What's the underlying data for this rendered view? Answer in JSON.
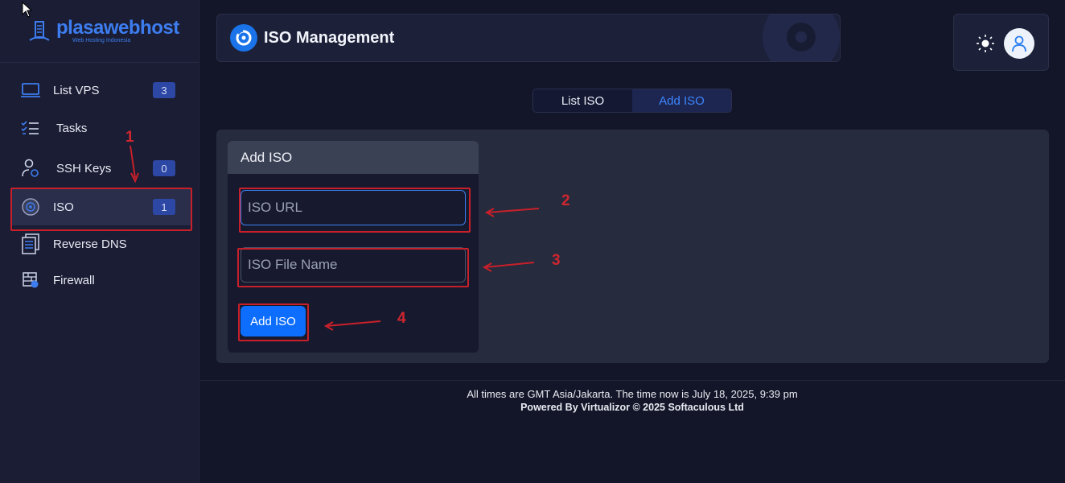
{
  "brand": {
    "name": "plasawebhost",
    "tagline": "Web Hosting Indonesia"
  },
  "sidebar": {
    "items": [
      {
        "label": "List VPS",
        "badge": "3",
        "icon": "laptop-icon"
      },
      {
        "label": "Tasks",
        "badge": "",
        "icon": "tasks-icon"
      },
      {
        "label": "SSH Keys",
        "badge": "0",
        "icon": "user-key-icon"
      },
      {
        "label": "ISO",
        "badge": "1",
        "icon": "disc-icon",
        "active": true
      },
      {
        "label": "Reverse DNS",
        "badge": "",
        "icon": "dns-icon"
      },
      {
        "label": "Firewall",
        "badge": "",
        "icon": "firewall-icon"
      }
    ]
  },
  "header": {
    "title": "ISO Management",
    "icon": "iso-disc-icon"
  },
  "topbar": {
    "theme_icon": "sun-icon",
    "avatar_icon": "user-icon"
  },
  "tabs": [
    {
      "label": "List ISO",
      "active": false
    },
    {
      "label": "Add ISO",
      "active": true
    }
  ],
  "form": {
    "title": "Add ISO",
    "iso_url": {
      "placeholder": "ISO URL",
      "value": ""
    },
    "iso_file_name": {
      "placeholder": "ISO File Name",
      "value": ""
    },
    "submit_label": "Add ISO"
  },
  "annotations": [
    "1",
    "2",
    "3",
    "4"
  ],
  "footer": {
    "time_text": "All times are GMT Asia/Jakarta. The time now is July 18, 2025, 9:39 pm",
    "powered_text": "Powered By Virtualizor © 2025 Softaculous Ltd"
  },
  "colors": {
    "accent": "#0d6efd",
    "annotation": "#c8202a",
    "background": "#131628"
  }
}
